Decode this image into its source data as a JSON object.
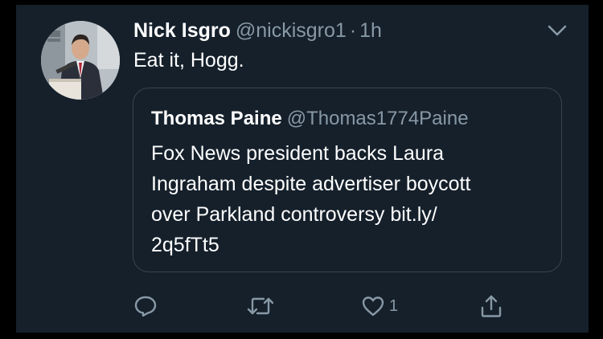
{
  "tweet": {
    "display_name": "Nick Isgro",
    "handle": "@nickisgro1",
    "separator": "·",
    "time": "1h",
    "text": "Eat it, Hogg."
  },
  "quoted_tweet": {
    "display_name": "Thomas Paine",
    "handle": "@Thomas1774Paine",
    "text_lines": [
      "Fox News president backs Laura",
      "Ingraham despite advertiser boycott",
      "over Parkland controversy bit.ly/",
      "2q5fTt5"
    ]
  },
  "actions": {
    "reply_icon": "reply-icon",
    "retweet_icon": "retweet-icon",
    "like_icon": "heart-icon",
    "like_count": "1",
    "share_icon": "share-icon"
  },
  "icons": {
    "menu": "chevron-down-icon"
  },
  "colors": {
    "background": "#15202b",
    "text_primary": "#ffffff",
    "text_secondary": "#8899a6",
    "border": "#38444d"
  }
}
